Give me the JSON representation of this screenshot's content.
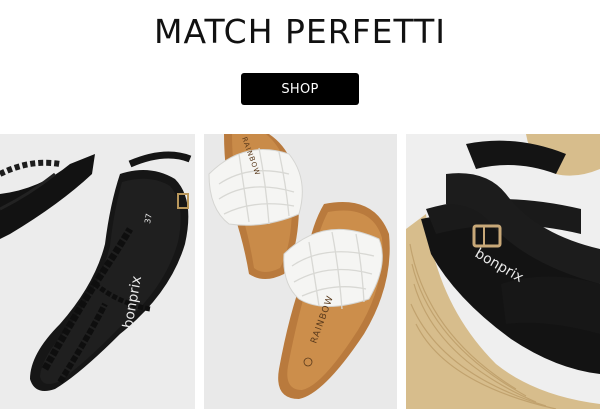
{
  "promo": {
    "headline": "MATCH PERFETTI",
    "shop_label": "SHOP"
  },
  "products": [
    {
      "name": "braided-thong-sandal",
      "insole_brand": "bonprix",
      "insole_size": "37",
      "color": "#141414"
    },
    {
      "name": "woven-slide-sandal",
      "insole_brand": "RAINBOW",
      "insole_brand_top": "RAINBOW",
      "color": "#f4f4f2"
    },
    {
      "name": "espadrille-wedge-sandal",
      "insole_brand": "bonprix",
      "color": "#141414"
    }
  ]
}
